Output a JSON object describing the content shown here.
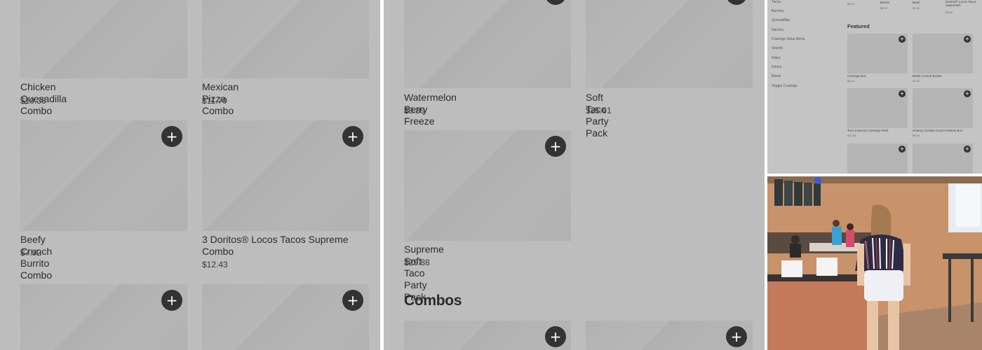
{
  "panel1": {
    "items": [
      {
        "name": "Chicken Quesadilla Combo",
        "price": "$10.36"
      },
      {
        "name": "Mexican Pizza Combo",
        "price": "$11.70"
      },
      {
        "name": "Beefy Crunch Burrito Combo",
        "price": "$7.92"
      },
      {
        "name": "3 Doritos® Locos Tacos Supreme Combo",
        "price": "$12.43"
      }
    ],
    "add_label": "+"
  },
  "panel2": {
    "items": [
      {
        "name": "Watermelon Berry Freeze",
        "price": "$3.89"
      },
      {
        "name": "Soft Taco Party Pack",
        "price": "$25.61"
      },
      {
        "name": "Supreme Soft Taco Party Pack",
        "price": "$29.88"
      }
    ],
    "section_title": "Combos",
    "add_label": "+"
  },
  "panel3": {
    "categories": [
      "Tacos",
      "Burritos",
      "Quesadillas",
      "Nachos",
      "Cravings Value Menu",
      "Sweets",
      "Sides",
      "Drinks",
      "Bowls",
      "Veggie Cravings"
    ],
    "top_items": [
      {
        "name": "",
        "price": "$6.10"
      },
      {
        "name": "Burrito",
        "price": "$3.79"
      },
      {
        "name": "Bowl",
        "price": "$9.53"
      },
      {
        "name": "Doritos® Locos Tacos Supreme®",
        "price": "$3.89"
      }
    ],
    "featured_title": "Featured",
    "featured": [
      {
        "name": "Cravings Box",
        "price": "$6.10"
      },
      {
        "name": "Beefy Crunch Burrito",
        "price": "$3.04"
      },
      {
        "name": "Taco & Burrito Cravings Pack",
        "price": "$21.34"
      },
      {
        "name": "Cheesy Gordita Crunch Deluxe Box",
        "price": "$6.59"
      }
    ],
    "add_label": "+"
  },
  "photo": {
    "wall_color": "#c8926a",
    "counter_color": "#c57a5c",
    "floor_color": "#a8856a"
  }
}
